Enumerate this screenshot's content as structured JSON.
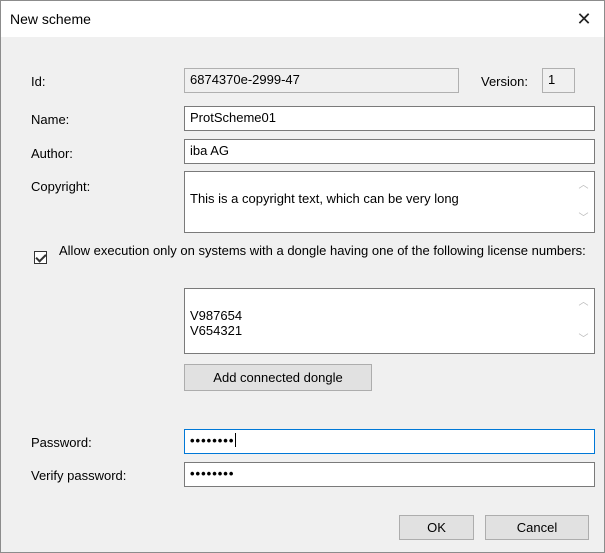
{
  "window": {
    "title": "New scheme",
    "close_glyph": "✕"
  },
  "form": {
    "id_label": "Id:",
    "id_value": "6874370e-2999-47",
    "version_label": "Version:",
    "version_value": "1",
    "name_label": "Name:",
    "name_value": "ProtScheme01",
    "author_label": "Author:",
    "author_value": "iba AG",
    "copyright_label": "Copyright:",
    "copyright_value": "This is a copyright text, which can be very long",
    "dongle_checkbox_label": "Allow execution only on systems with a dongle having one of the following license numbers:",
    "dongle_checked": true,
    "license_numbers": "V987654\nV654321",
    "add_dongle_label": "Add connected dongle",
    "password_label": "Password:",
    "password_value": "••••••••",
    "verify_label": "Verify password:",
    "verify_value": "••••••••"
  },
  "buttons": {
    "ok": "OK",
    "cancel": "Cancel"
  },
  "icons": {
    "close": "close-icon",
    "scroll_up": "chevron-up-icon",
    "scroll_down": "chevron-down-icon",
    "check": "check-icon"
  },
  "colors": {
    "focus_border": "#0078d7",
    "dialog_bg": "#f0f0f0"
  }
}
